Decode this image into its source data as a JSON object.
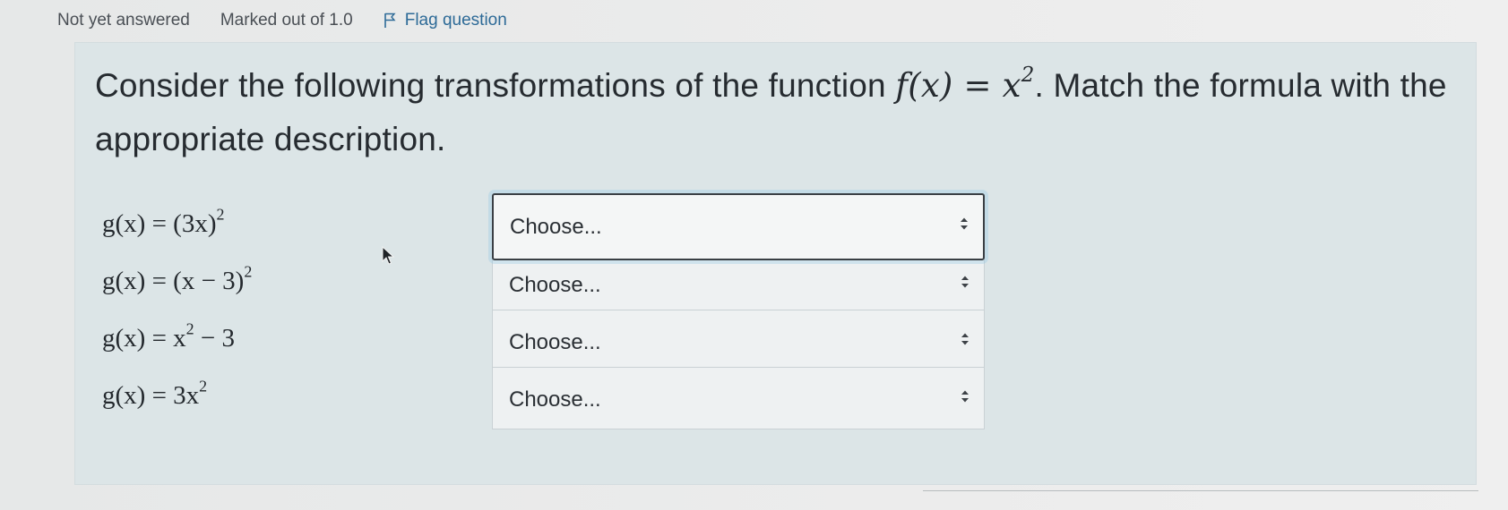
{
  "info": {
    "status": "Not yet answered",
    "marks": "Marked out of 1.0",
    "flag_label": "Flag question",
    "flag_icon": "flag-icon"
  },
  "question": {
    "text_before": "Consider the following transformations of the function ",
    "f_x": "f(x) = x",
    "exponent": "2",
    "text_after": ". Match the formula with the appropriate description."
  },
  "rows": [
    {
      "formula_base": "g(x) = (3x)",
      "formula_sup": "2",
      "formula_tail": "",
      "select_value": "Choose..."
    },
    {
      "formula_base": "g(x) = (x − 3)",
      "formula_sup": "2",
      "formula_tail": "",
      "select_value": "Choose..."
    },
    {
      "formula_base": "g(x) = x",
      "formula_sup": "2",
      "formula_tail": " − 3",
      "select_value": "Choose..."
    },
    {
      "formula_base": "g(x) = 3x",
      "formula_sup": "2",
      "formula_tail": "",
      "select_value": "Choose..."
    }
  ],
  "colors": {
    "link": "#2d6a97",
    "panel": "#dce5e7",
    "select_bg": "#eef1f2"
  }
}
